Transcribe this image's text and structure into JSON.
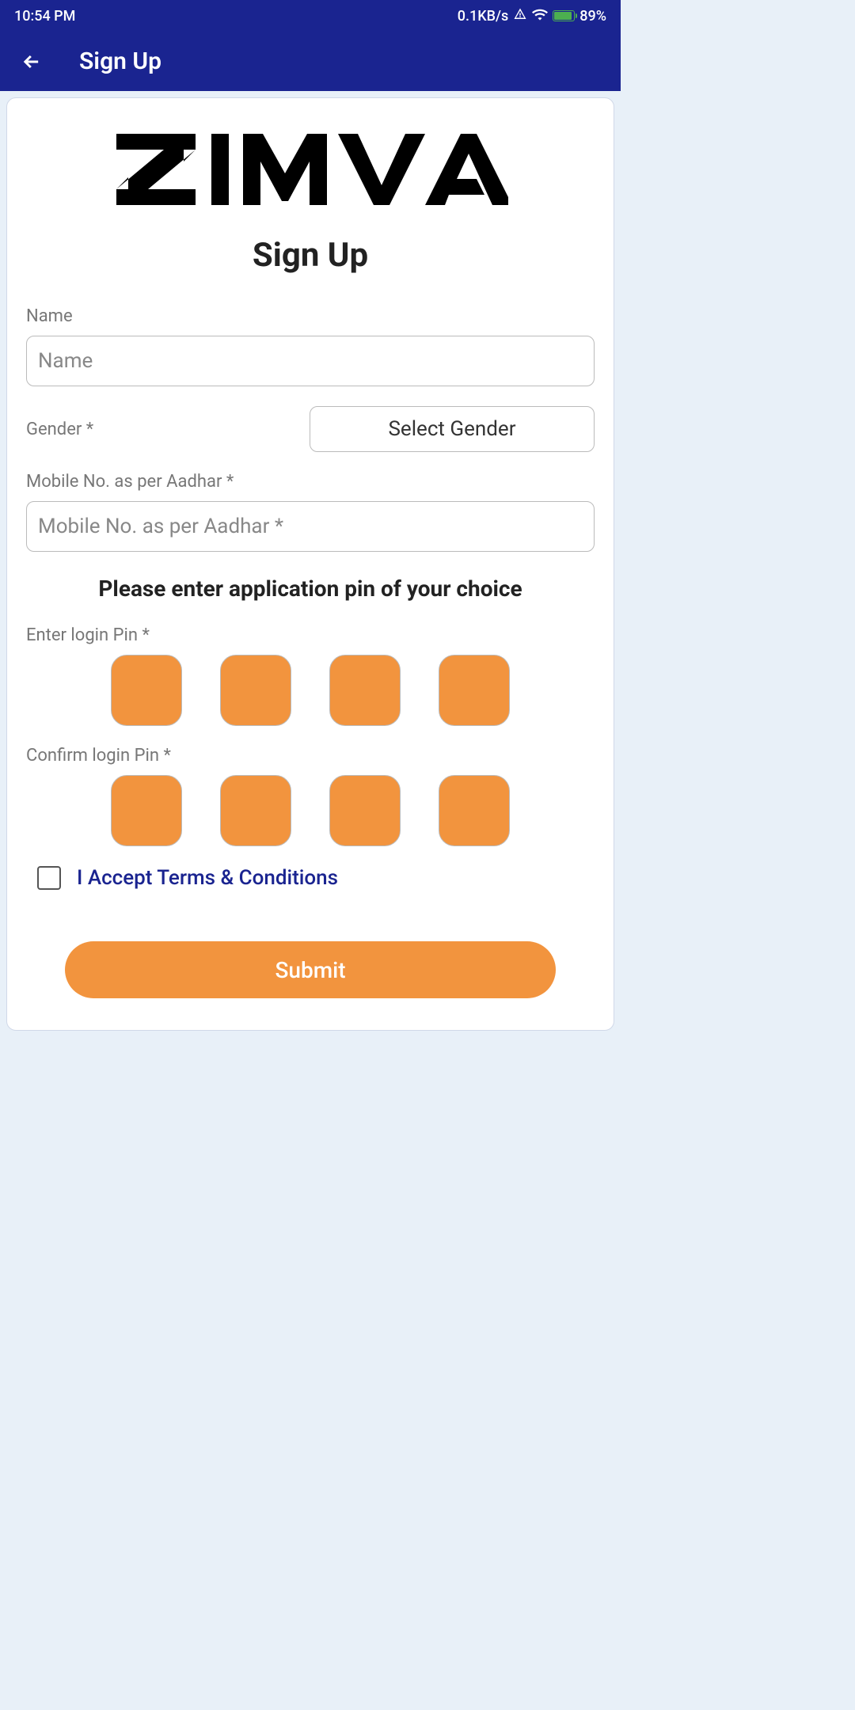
{
  "statusBar": {
    "time": "10:54 PM",
    "dataRate": "0.1KB/s",
    "batteryPercent": "89%"
  },
  "appBar": {
    "title": "Sign Up"
  },
  "card": {
    "title": "Sign Up",
    "nameLabel": "Name",
    "namePlaceholder": "Name",
    "genderLabel": "Gender *",
    "genderSelectText": "Select Gender",
    "mobileLabel": "Mobile No. as per Aadhar *",
    "mobilePlaceholder": "Mobile No. as per Aadhar *",
    "pinInstruction": "Please enter application pin of your choice",
    "enterPinLabel": "Enter login Pin *",
    "confirmPinLabel": "Confirm login Pin *",
    "termsText": "I Accept Terms & Conditions",
    "submitLabel": "Submit"
  }
}
